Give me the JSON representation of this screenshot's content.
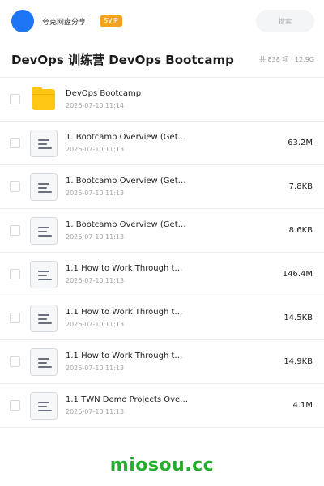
{
  "header": {
    "user_name": "夸克网盘分享",
    "badge": "SVIP",
    "search_placeholder": "搜索"
  },
  "folder": {
    "title": "DevOps 训练营 DevOps Bootcamp",
    "meta": "共 838 项 · 12.9G"
  },
  "files": [
    {
      "name": "DevOps Bootcamp",
      "date": "2026-07-10 11:14",
      "size": "",
      "type": "folder-icon"
    },
    {
      "name": "1. Bootcamp Overview (Get…",
      "date": "2026-07-10 11:13",
      "size": "63.2M",
      "type": "document-icon"
    },
    {
      "name": "1. Bootcamp Overview (Get…",
      "date": "2026-07-10 11:13",
      "size": "7.8KB",
      "type": "document-icon"
    },
    {
      "name": "1. Bootcamp Overview (Get…",
      "date": "2026-07-10 11:13",
      "size": "8.6KB",
      "type": "document-icon"
    },
    {
      "name": "1.1 How to Work Through t…",
      "date": "2026-07-10 11:13",
      "size": "146.4M",
      "type": "document-icon"
    },
    {
      "name": "1.1 How to Work Through t…",
      "date": "2026-07-10 11:13",
      "size": "14.5KB",
      "type": "document-icon"
    },
    {
      "name": "1.1 How to Work Through t…",
      "date": "2026-07-10 11:13",
      "size": "14.9KB",
      "type": "document-icon"
    },
    {
      "name": "1.1 TWN Demo Projects Ove…",
      "date": "2026-07-10 11:13",
      "size": "4.1M",
      "type": "document-icon"
    }
  ],
  "footer": {
    "brand": "miosou.cc"
  },
  "colors": {
    "avatar": "#1d74f5",
    "badge": "#f7a21b",
    "folder": "#fdc713",
    "brand": "#22b02c"
  }
}
